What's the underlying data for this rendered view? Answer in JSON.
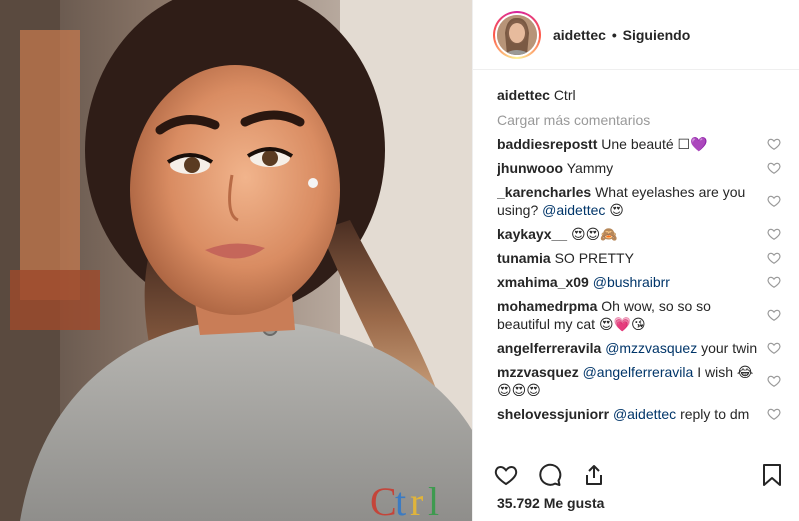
{
  "header": {
    "username": "aidettec",
    "separator": "•",
    "follow_status": "Siguiendo"
  },
  "caption": {
    "user": "aidettec",
    "text": "Ctrl"
  },
  "load_more": "Cargar más comentarios",
  "comments": [
    {
      "user": "baddiesrepostt",
      "text": "Une beauté ☐💜"
    },
    {
      "user": "jhunwooo",
      "text": "Yammy"
    },
    {
      "user": "_karencharles",
      "text": "What eyelashes are you using? ",
      "mention": "@aidettec",
      "after": " 😍"
    },
    {
      "user": "kaykayx__",
      "text": "😍😍🙈"
    },
    {
      "user": "tunamia",
      "text": "SO PRETTY"
    },
    {
      "user": "xmahima_x09",
      "text": "",
      "mention": "@bushraibrr",
      "after": ""
    },
    {
      "user": "mohamedrpma",
      "text": "Oh wow, so so so beautiful my cat 😍💗😘"
    },
    {
      "user": "angelferreravila",
      "text": "",
      "mention": "@mzzvasquez",
      "after": " your twin"
    },
    {
      "user": "mzzvasquez",
      "text": "",
      "mention": "@angelferreravila",
      "after": " I wish 😂😍😍😍"
    },
    {
      "user": "shelovessjuniorr",
      "text": "",
      "mention": "@aidettec",
      "after": " reply to dm"
    }
  ],
  "likes": "35.792 Me gusta",
  "icons": {
    "like": "heart-icon",
    "comment": "comment-icon",
    "share": "share-icon",
    "save": "bookmark-icon"
  },
  "colors": {
    "text": "#262626",
    "muted": "#999999",
    "mention": "#003569"
  }
}
